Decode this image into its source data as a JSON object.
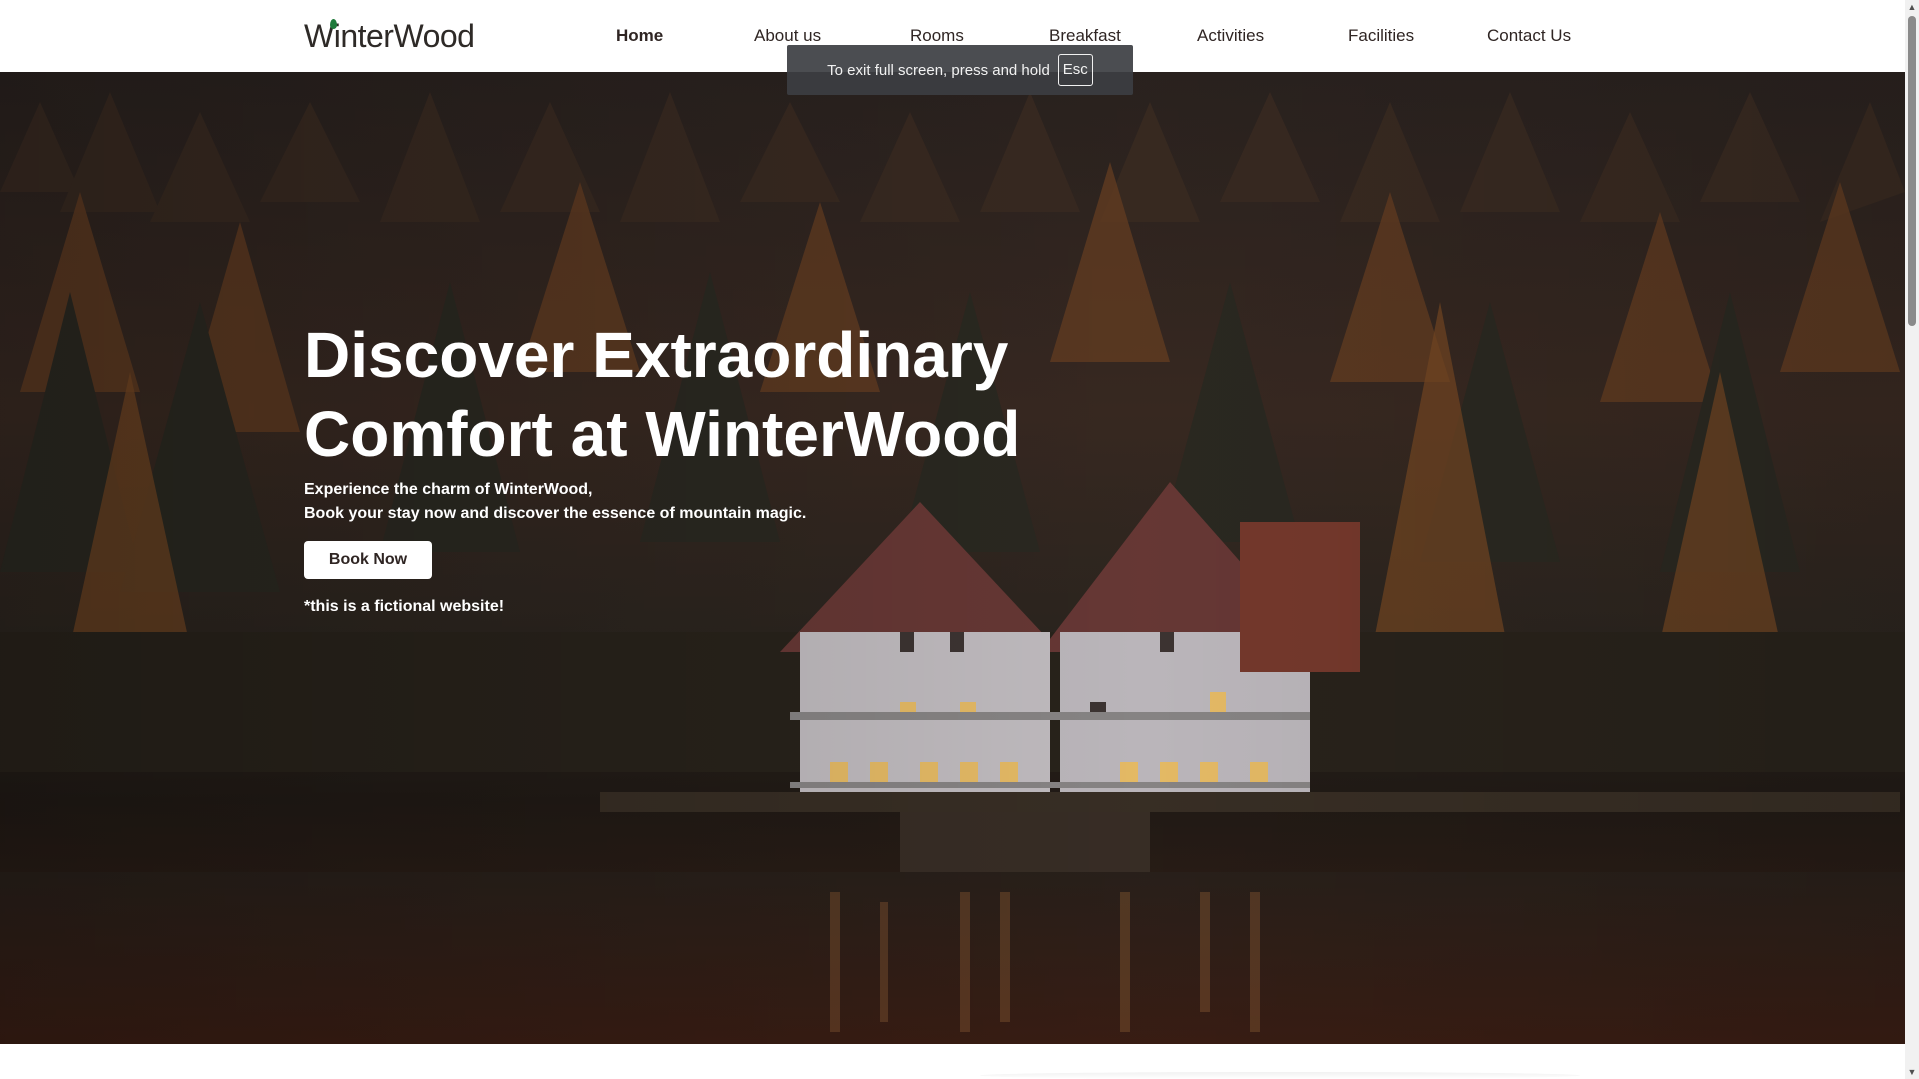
{
  "brand": {
    "name": "WinterWood"
  },
  "nav": {
    "items": [
      {
        "label": "Home",
        "active": true
      },
      {
        "label": "About us"
      },
      {
        "label": "Rooms"
      },
      {
        "label": "Breakfast"
      },
      {
        "label": "Activities"
      },
      {
        "label": "Facilities"
      },
      {
        "label": "Contact Us"
      }
    ]
  },
  "fullscreen_toast": {
    "text": "To exit full screen, press and hold",
    "key": "Esc"
  },
  "hero": {
    "title_line1": "Discover Extraordinary",
    "title_line2": "Comfort at WinterWood",
    "subtitle_line1": "Experience the charm of WinterWood,",
    "subtitle_line2": "Book your stay now and discover the essence of mountain magic.",
    "cta_label": "Book Now",
    "note": "*this is a fictional website!"
  },
  "colors": {
    "text_dark": "#2f2523",
    "toast_bg": "#3c3e42",
    "white": "#ffffff"
  },
  "icons": {
    "scroll_up": "triangle-up-icon",
    "scroll_down": "triangle-down-icon",
    "logo_leaf": "leaf-icon"
  }
}
